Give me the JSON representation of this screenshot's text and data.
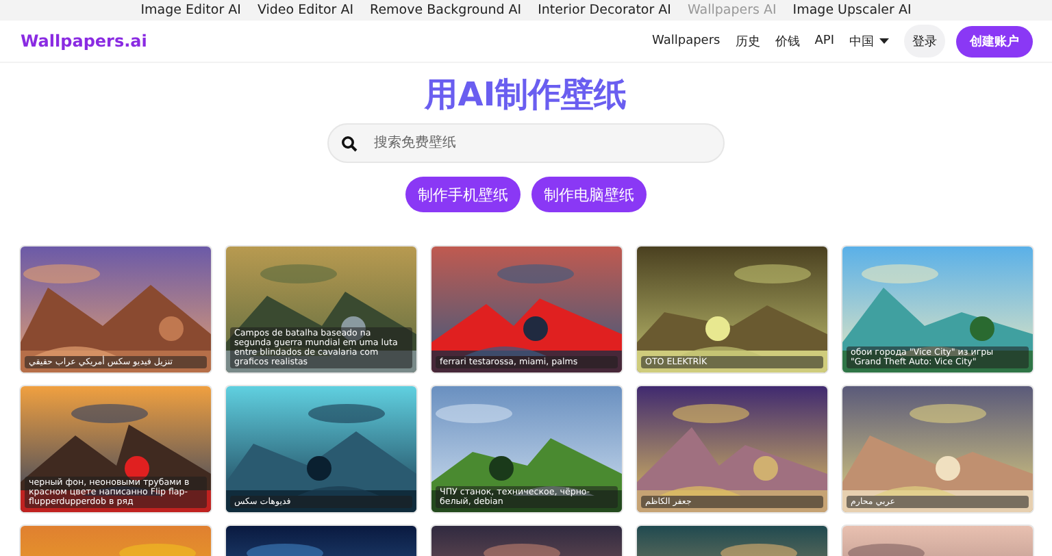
{
  "top_links": [
    {
      "label": "Image Editor AI",
      "selected": false
    },
    {
      "label": "Video Editor AI",
      "selected": false
    },
    {
      "label": "Remove Background AI",
      "selected": false
    },
    {
      "label": "Interior Decorator AI",
      "selected": false
    },
    {
      "label": "Wallpapers AI",
      "selected": true
    },
    {
      "label": "Image Upscaler AI",
      "selected": false
    }
  ],
  "header": {
    "logo": "Wallpapers.ai",
    "nav": [
      {
        "label": "Wallpapers",
        "kind": "link"
      },
      {
        "label": "历史",
        "kind": "link"
      },
      {
        "label": "价钱",
        "kind": "link"
      },
      {
        "label": "API",
        "kind": "link"
      },
      {
        "label": "中国",
        "kind": "dropdown"
      }
    ],
    "login": "登录",
    "signup": "创建账户"
  },
  "hero": {
    "title": "用AI制作壁纸",
    "search": {
      "placeholder": "搜索免费壁纸"
    },
    "buttons": [
      "制作手机壁纸",
      "制作电脑壁纸"
    ]
  },
  "cards": [
    {
      "kind": "picture",
      "caption": "تنزيل فيديو سكس أمريكي عراب حقيقي"
    },
    {
      "kind": "picture",
      "caption": "Campos de batalha baseado na segunda guerra mundial em uma luta entre blindados de cavalaria com graficos realistas"
    },
    {
      "kind": "picture",
      "caption": "ferrari testarossa, miami, palms"
    },
    {
      "kind": "picture",
      "caption": "OTO ELEKTRİK"
    },
    {
      "kind": "picture",
      "caption": "обои города \"Vice City\" из игры \"Grand Theft Auto: Vice City\""
    },
    {
      "kind": "picture",
      "caption": "черный фон, неоновыми трубами в красном цвете написанно Flip flap-flupperdupperdob в ряд"
    },
    {
      "kind": "picture",
      "caption": "فديوهات سكس"
    },
    {
      "kind": "picture",
      "caption": "ЧПУ станок, техническое, чёрно-белый, debian"
    },
    {
      "kind": "picture",
      "caption": "جعفر الكاظم"
    },
    {
      "kind": "picture",
      "caption": "عربي محارم"
    },
    {
      "kind": "picture"
    },
    {
      "kind": "picture"
    },
    {
      "kind": "picture"
    },
    {
      "kind": "picture"
    },
    {
      "kind": "picture"
    }
  ]
}
